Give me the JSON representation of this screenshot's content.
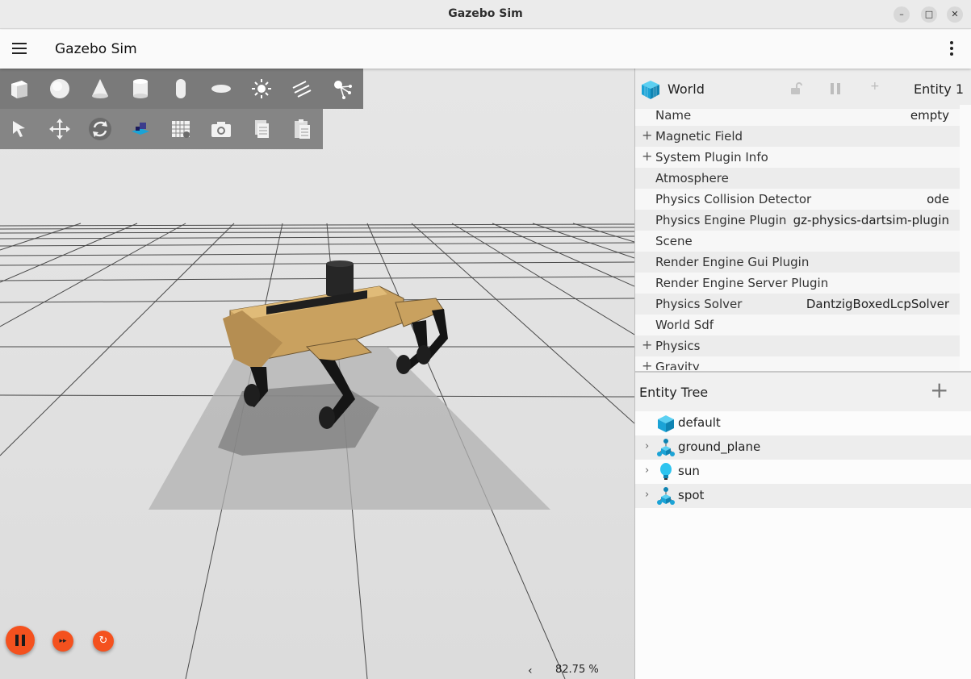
{
  "window": {
    "title": "Gazebo Sim",
    "controls": [
      "–",
      "□",
      "✕"
    ]
  },
  "appbar": {
    "title": "Gazebo Sim"
  },
  "shapes_toolbar": [
    "box-icon",
    "sphere-icon",
    "cone-icon",
    "cylinder-icon",
    "capsule-icon",
    "ellipsoid-icon",
    "point-light-icon",
    "directional-light-icon",
    "spot-light-icon"
  ],
  "transform_toolbar": [
    "select-icon",
    "translate-icon",
    "rotate-icon",
    "snap-icon",
    "grid-icon",
    "screenshot-icon",
    "copy-icon",
    "paste-icon"
  ],
  "sim_controls": {
    "step_glyph": "▸▸",
    "reset_glyph": "↻",
    "rtf_arrow": "‹",
    "rtf": "82.75 %"
  },
  "component_inspector": {
    "header": "World",
    "add_glyph": "+",
    "entity": "Entity 1",
    "rows": [
      {
        "label": "Name",
        "value": "empty",
        "expand": ""
      },
      {
        "label": "Magnetic Field",
        "value": "",
        "expand": "+"
      },
      {
        "label": "System Plugin Info",
        "value": "",
        "expand": "+"
      },
      {
        "label": "Atmosphere",
        "value": "",
        "expand": ""
      },
      {
        "label": "Physics Collision Detector",
        "value": "ode",
        "expand": ""
      },
      {
        "label": "Physics Engine Plugin",
        "value": "gz-physics-dartsim-plugin",
        "expand": ""
      },
      {
        "label": "Scene",
        "value": "",
        "expand": ""
      },
      {
        "label": "Render Engine Gui Plugin",
        "value": "",
        "expand": ""
      },
      {
        "label": "Render Engine Server Plugin",
        "value": "",
        "expand": ""
      },
      {
        "label": "Physics Solver",
        "value": "DantzigBoxedLcpSolver",
        "expand": ""
      },
      {
        "label": "World Sdf",
        "value": "",
        "expand": ""
      },
      {
        "label": "Physics",
        "value": "",
        "expand": "+"
      },
      {
        "label": "Gravity",
        "value": "",
        "expand": "+"
      }
    ]
  },
  "entity_tree": {
    "title": "Entity Tree",
    "add_glyph": "+",
    "items": [
      {
        "label": "default",
        "icon": "world-icon",
        "chevron": ""
      },
      {
        "label": "ground_plane",
        "icon": "model-icon",
        "chevron": "›"
      },
      {
        "label": "sun",
        "icon": "light-icon",
        "chevron": "›"
      },
      {
        "label": "spot",
        "icon": "model-icon",
        "chevron": "›"
      }
    ]
  },
  "colors": {
    "accent": "#f4511e",
    "toolbar": "#7a7a7a",
    "robot": "#c9a15f",
    "icon_blue": "#1ba3d6"
  }
}
